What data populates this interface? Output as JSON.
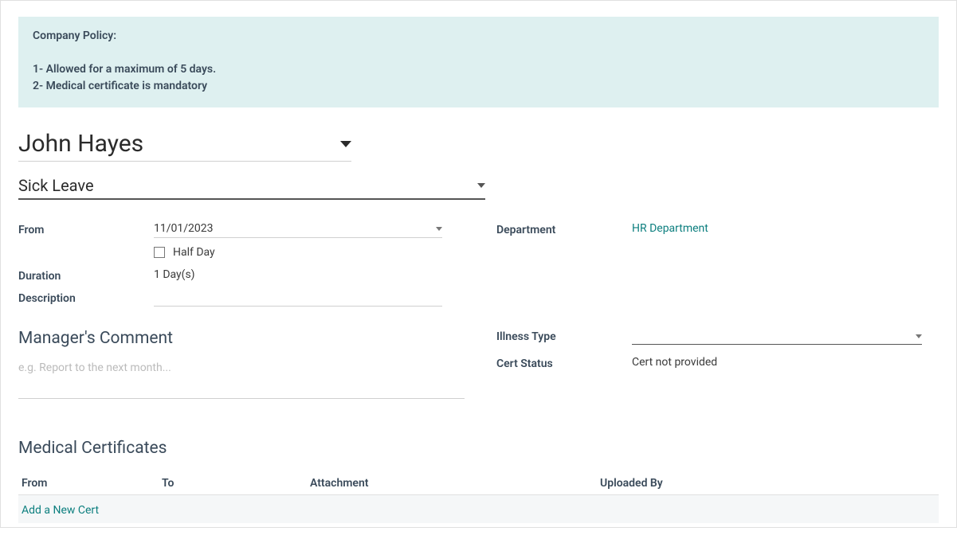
{
  "policy": {
    "title": "Company Policy:",
    "line1": "1- Allowed for a maximum of 5 days.",
    "line2": "2- Medical certificate is mandatory"
  },
  "employee": {
    "name": "John Hayes"
  },
  "leave_type": "Sick Leave",
  "form": {
    "from_label": "From",
    "from_value": "11/01/2023",
    "half_day_label": "Half Day",
    "duration_label": "Duration",
    "duration_value": "1  Day(s)",
    "description_label": "Description",
    "department_label": "Department",
    "department_value": "HR Department"
  },
  "manager": {
    "title": "Manager's Comment",
    "placeholder": "e.g. Report to the next month...",
    "illness_type_label": "Illness Type",
    "cert_status_label": "Cert Status",
    "cert_status_value": "Cert not provided"
  },
  "certificates": {
    "title": "Medical Certificates",
    "col_from": "From",
    "col_to": "To",
    "col_attachment": "Attachment",
    "col_uploaded_by": "Uploaded By",
    "add_link": "Add a New Cert"
  }
}
